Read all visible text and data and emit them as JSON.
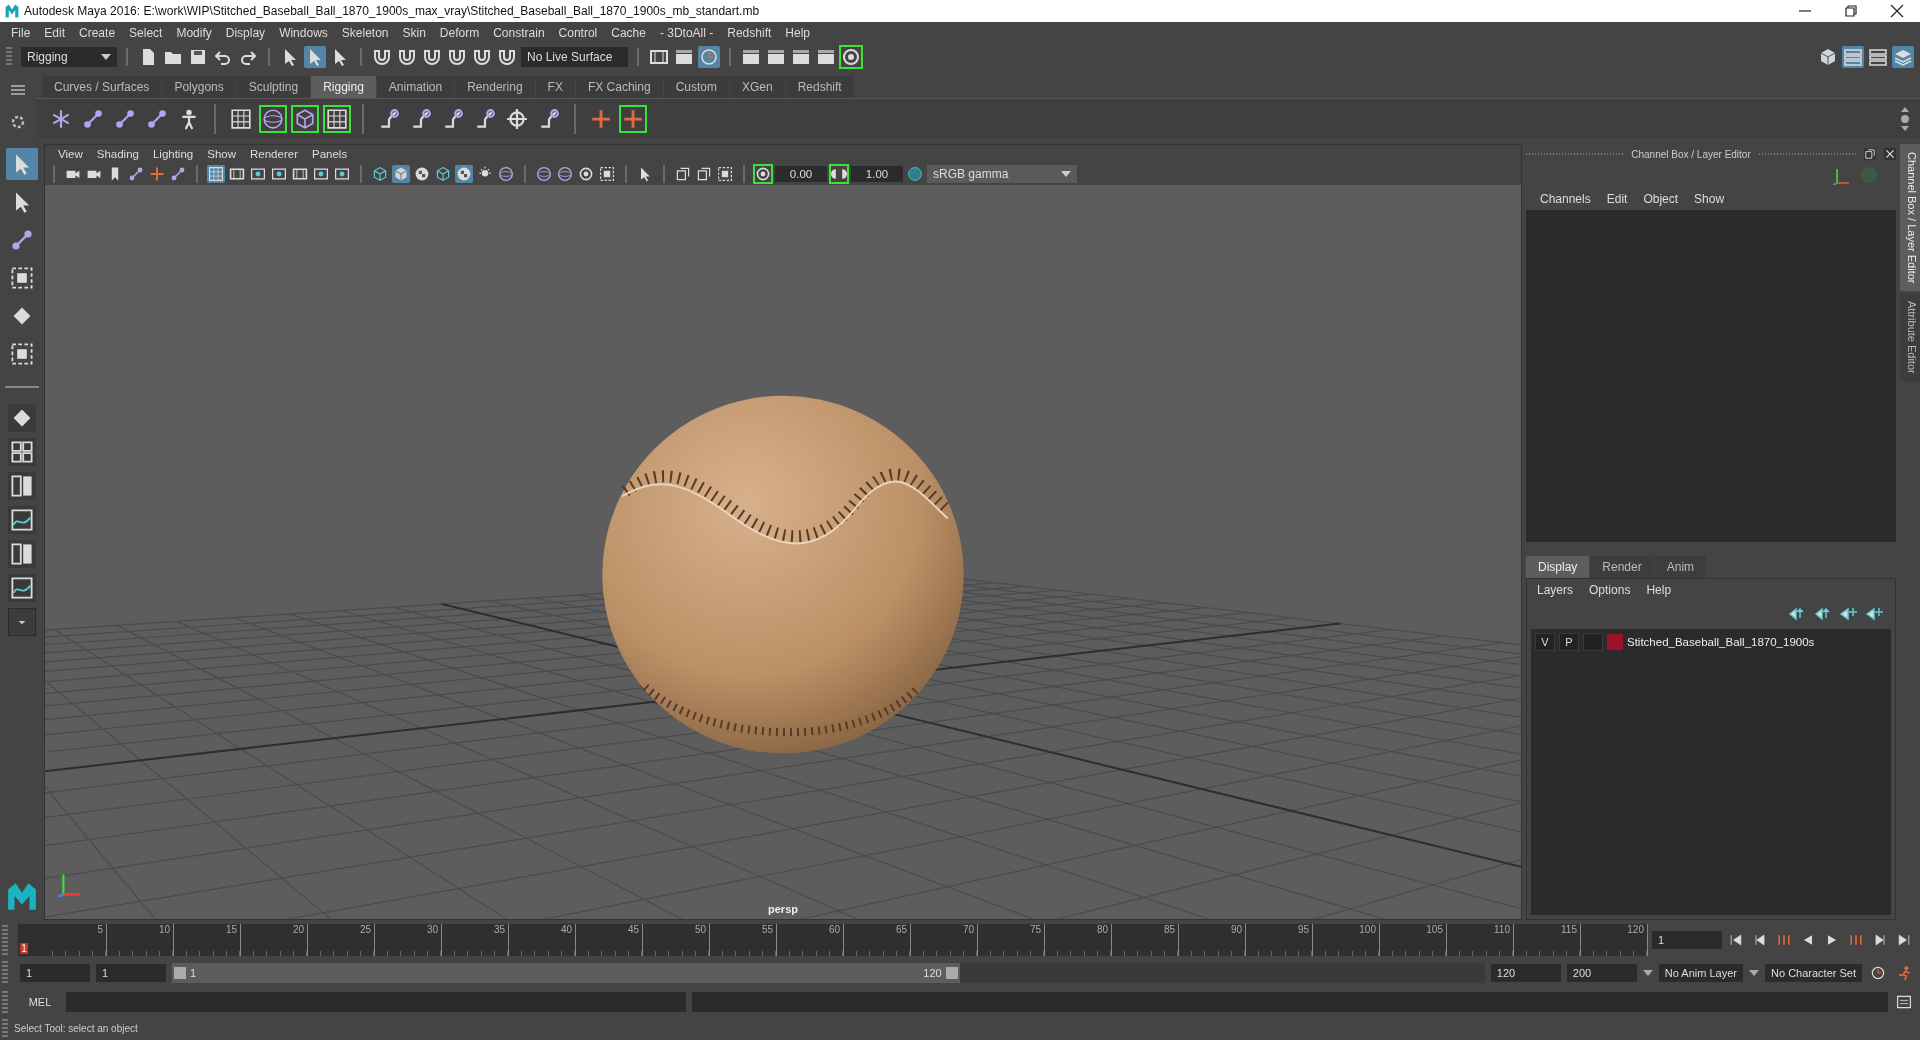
{
  "window": {
    "title": "Autodesk Maya 2016: E:\\work\\WIP\\Stitched_Baseball_Ball_1870_1900s_max_vray\\Stitched_Baseball_Ball_1870_1900s_mb_standart.mb"
  },
  "menu": [
    "File",
    "Edit",
    "Create",
    "Select",
    "Modify",
    "Display",
    "Windows",
    "Skeleton",
    "Skin",
    "Deform",
    "Constrain",
    "Control",
    "Cache",
    "- 3DtoAll -",
    "Redshift",
    "Help"
  ],
  "status_line": {
    "menu_set": "Rigging",
    "live_surface": "No Live Surface"
  },
  "shelf_tabs": [
    {
      "label": "Curves / Surfaces",
      "selected": false
    },
    {
      "label": "Polygons",
      "selected": false
    },
    {
      "label": "Sculpting",
      "selected": false
    },
    {
      "label": "Rigging",
      "selected": true
    },
    {
      "label": "Animation",
      "selected": false
    },
    {
      "label": "Rendering",
      "selected": false
    },
    {
      "label": "FX",
      "selected": false
    },
    {
      "label": "FX Caching",
      "selected": false
    },
    {
      "label": "Custom",
      "selected": false
    },
    {
      "label": "XGen",
      "selected": false
    },
    {
      "label": "Redshift",
      "selected": false
    }
  ],
  "tools": [
    {
      "kind": "select",
      "selected": true
    },
    {
      "kind": "lasso",
      "selected": false
    },
    {
      "kind": "paint",
      "selected": false
    },
    {
      "kind": "move",
      "selected": false
    },
    {
      "kind": "rotate",
      "selected": false
    },
    {
      "kind": "scale",
      "selected": false
    }
  ],
  "viewport": {
    "menu": [
      "View",
      "Shading",
      "Lighting",
      "Show",
      "Renderer",
      "Panels"
    ],
    "exposure": "0.00",
    "gamma": "1.00",
    "color_space": "sRGB gamma",
    "camera": "persp"
  },
  "channel_box": {
    "title": "Channel Box / Layer Editor",
    "menu": [
      "Channels",
      "Edit",
      "Object",
      "Show"
    ]
  },
  "layer_editor": {
    "tabs": [
      {
        "label": "Display",
        "selected": true
      },
      {
        "label": "Render",
        "selected": false
      },
      {
        "label": "Anim",
        "selected": false
      }
    ],
    "menu": [
      "Layers",
      "Options",
      "Help"
    ],
    "layers": [
      {
        "visible": "V",
        "playback": "P",
        "color": "#a0102e",
        "name": "Stitched_Baseball_Ball_1870_1900s"
      }
    ]
  },
  "side_tabs": [
    {
      "label": "Channel Box / Layer Editor",
      "selected": true
    },
    {
      "label": "Attribute Editor",
      "selected": false
    }
  ],
  "timeline": {
    "current": "1",
    "level": 0,
    "ticks": [
      "5",
      "10",
      "15",
      "20",
      "25",
      "30",
      "35",
      "40",
      "45",
      "50",
      "55",
      "60",
      "65",
      "70",
      "75",
      "80",
      "85",
      "90",
      "95",
      "100",
      "105",
      "110",
      "115",
      "120"
    ],
    "frame_field": "1"
  },
  "range": {
    "start": "1",
    "playback_start": "1",
    "slider_start": "1",
    "slider_end": "120",
    "level": 0.6,
    "playback_end": "120",
    "end": "200",
    "anim_layer": "No Anim Layer",
    "character_set": "No Character Set"
  },
  "command_line": {
    "label": "MEL"
  },
  "help_line": "Select Tool: select an object"
}
